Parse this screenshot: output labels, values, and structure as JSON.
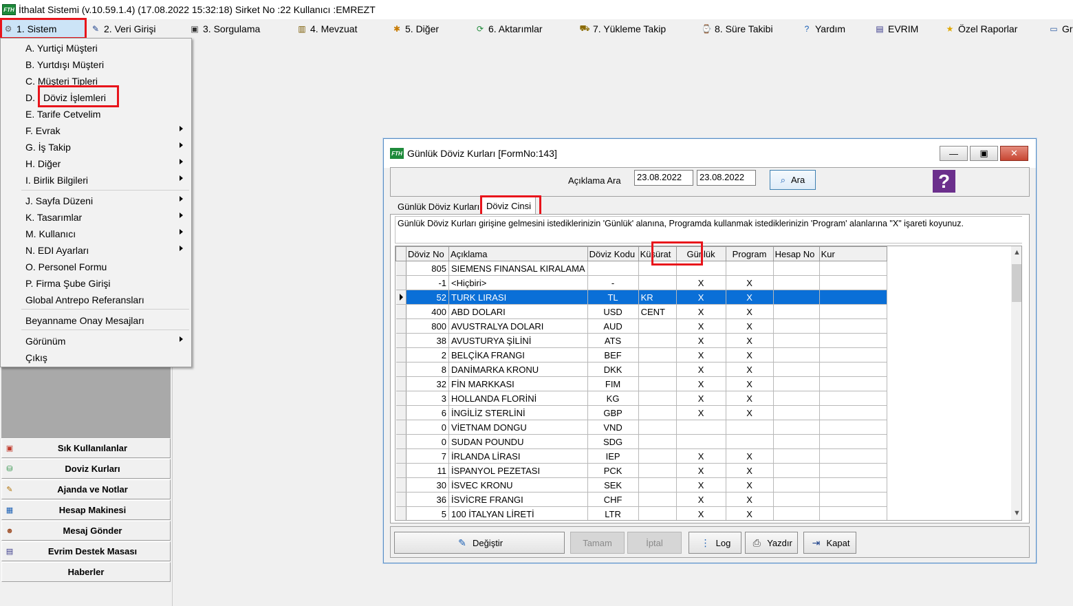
{
  "window_title": "İthalat Sistemi (v.10.59.1.4) (17.08.2022 15:32:18) Sirket No :22 Kullanıcı :EMREZT",
  "menubar": [
    {
      "label": "1.  Sistem",
      "icon": "gear-icon"
    },
    {
      "label": "2.   Veri Girişi",
      "icon": "pencil-icon"
    },
    {
      "label": "3.   Sorgulama",
      "icon": "query-icon"
    },
    {
      "label": "4.   Mevzuat",
      "icon": "books-icon"
    },
    {
      "label": "5.   Diğer",
      "icon": "other-icon"
    },
    {
      "label": "6.   Aktarımlar",
      "icon": "transfer-icon"
    },
    {
      "label": "7.   Yükleme Takip",
      "icon": "truck-icon"
    },
    {
      "label": "8. Süre Takibi",
      "icon": "clock-icon"
    },
    {
      "label": "Yardım",
      "icon": "help-icon"
    },
    {
      "label": "EVRIM",
      "icon": "book-icon"
    },
    {
      "label": "Özel Raporlar",
      "icon": "star-icon"
    },
    {
      "label": "Gr",
      "icon": "window-icon"
    }
  ],
  "system_menu": [
    {
      "label": "A.   Yurtiçi Müşteri",
      "submenu": false
    },
    {
      "label": "B.   Yurtdışı Müşteri",
      "submenu": false
    },
    {
      "label": "C.   Müşteri Tipleri",
      "submenu": false
    },
    {
      "label": "D.",
      "submenu": false
    },
    {
      "label": "E.   Tarife Cetvelim",
      "submenu": false
    },
    {
      "label": "F.   Evrak",
      "submenu": true
    },
    {
      "label": "G.   İş Takip",
      "submenu": true
    },
    {
      "label": "H.   Diğer",
      "submenu": true
    },
    {
      "label": "I.   Birlik Bilgileri",
      "submenu": true
    },
    {
      "label": "J.   Sayfa Düzeni",
      "submenu": true
    },
    {
      "label": "K.   Tasarımlar",
      "submenu": true
    },
    {
      "label": "M.   Kullanıcı",
      "submenu": true
    },
    {
      "label": "N.   EDI Ayarları",
      "submenu": true
    },
    {
      "label": "O.   Personel Formu",
      "submenu": false
    },
    {
      "label": "P.   Firma Şube Girişi",
      "submenu": false
    },
    {
      "label": "Global Antrepo Referansları",
      "submenu": false
    },
    {
      "label": "Beyanname Onay Mesajları",
      "submenu": false
    },
    {
      "label": "Görünüm",
      "submenu": true
    },
    {
      "label": "Çıkış",
      "submenu": false
    }
  ],
  "doviz_islemleri_label": "Döviz İşlemleri",
  "left_buttons": [
    {
      "label": "Sık Kullanılanlar",
      "icon": "favorites-icon"
    },
    {
      "label": "Doviz Kurları",
      "icon": "currency-icon"
    },
    {
      "label": "Ajanda ve Notlar",
      "icon": "notes-icon"
    },
    {
      "label": "Hesap Makinesi",
      "icon": "calculator-icon"
    },
    {
      "label": "Mesaj Gönder",
      "icon": "users-icon"
    },
    {
      "label": "Evrim Destek Masası",
      "icon": "support-icon"
    },
    {
      "label": "Haberler",
      "icon": ""
    }
  ],
  "dialog": {
    "title": "Günlük Döviz Kurları [FormNo:143]",
    "search_label": "Açıklama Ara",
    "date_from": "23.08.2022",
    "date_to": "23.08.2022",
    "search_button": "Ara",
    "tabs": [
      "Günlük Döviz Kurları",
      "Döviz Cinsi"
    ],
    "info_text": "Günlük Döviz Kurları girişine gelmesini istediklerinizin 'Günlük' alanına, Programda kullanmak istediklerinizin 'Program' alanlarına \"X\" işareti koyunuz.",
    "columns": [
      "Döviz No",
      "Açıklama",
      "Döviz Kodu",
      "Küsürat",
      "Günlük",
      "Program",
      "Hesap No",
      "Kur"
    ],
    "selected_row": 2,
    "rows": [
      [
        "805",
        "SIEMENS FINANSAL KIRALAMA",
        "",
        "",
        "",
        "",
        "",
        ""
      ],
      [
        "-1",
        "<Hiçbiri>",
        "-",
        "",
        "X",
        "X",
        "",
        ""
      ],
      [
        "52",
        "TURK LIRASI",
        "TL",
        "KR",
        "X",
        "X",
        "",
        ""
      ],
      [
        "400",
        "ABD DOLARI",
        "USD",
        "CENT",
        "X",
        "X",
        "",
        ""
      ],
      [
        "800",
        "AVUSTRALYA DOLARI",
        "AUD",
        "",
        "X",
        "X",
        "",
        ""
      ],
      [
        "38",
        "AVUSTURYA ŞİLİNİ",
        "ATS",
        "",
        "X",
        "X",
        "",
        ""
      ],
      [
        "2",
        "BELÇİKA FRANGI",
        "BEF",
        "",
        "X",
        "X",
        "",
        ""
      ],
      [
        "8",
        "DANİMARKA KRONU",
        "DKK",
        "",
        "X",
        "X",
        "",
        ""
      ],
      [
        "32",
        "FİN MARKKASI",
        "FIM",
        "",
        "X",
        "X",
        "",
        ""
      ],
      [
        "3",
        "HOLLANDA FLORİNİ",
        "KG",
        "",
        "X",
        "X",
        "",
        ""
      ],
      [
        "6",
        "İNGİLİZ STERLİNİ",
        "GBP",
        "",
        "X",
        "X",
        "",
        ""
      ],
      [
        "0",
        "VİETNAM DONGU",
        "VND",
        "",
        "",
        "",
        "",
        ""
      ],
      [
        "0",
        "SUDAN POUNDU",
        "SDG",
        "",
        "",
        "",
        "",
        ""
      ],
      [
        "7",
        "İRLANDA LİRASI",
        "IEP",
        "",
        "X",
        "X",
        "",
        ""
      ],
      [
        "11",
        "İSPANYOL PEZETASI",
        "PCK",
        "",
        "X",
        "X",
        "",
        ""
      ],
      [
        "30",
        "İSVEC KRONU",
        "SEK",
        "",
        "X",
        "X",
        "",
        ""
      ],
      [
        "36",
        "İSVİCRE FRANGI",
        "CHF",
        "",
        "X",
        "X",
        "",
        ""
      ],
      [
        "5",
        "100 İTALYAN LİRETİ",
        "LTR",
        "",
        "X",
        "X",
        "",
        ""
      ]
    ],
    "buttons": [
      {
        "label": "Değiştir",
        "icon": "edit-icon",
        "enabled": true
      },
      {
        "label": "Tamam",
        "icon": "",
        "enabled": false
      },
      {
        "label": "İptal",
        "icon": "",
        "enabled": false
      },
      {
        "label": "Log",
        "icon": "log-icon",
        "enabled": true
      },
      {
        "label": "Yazdır",
        "icon": "printer-icon",
        "enabled": true
      },
      {
        "label": "Kapat",
        "icon": "exit-icon",
        "enabled": true
      }
    ]
  },
  "colors": {
    "selection": "#0a6fd7",
    "highlight": "#e8141b",
    "menu_active": "#cce4f7"
  }
}
